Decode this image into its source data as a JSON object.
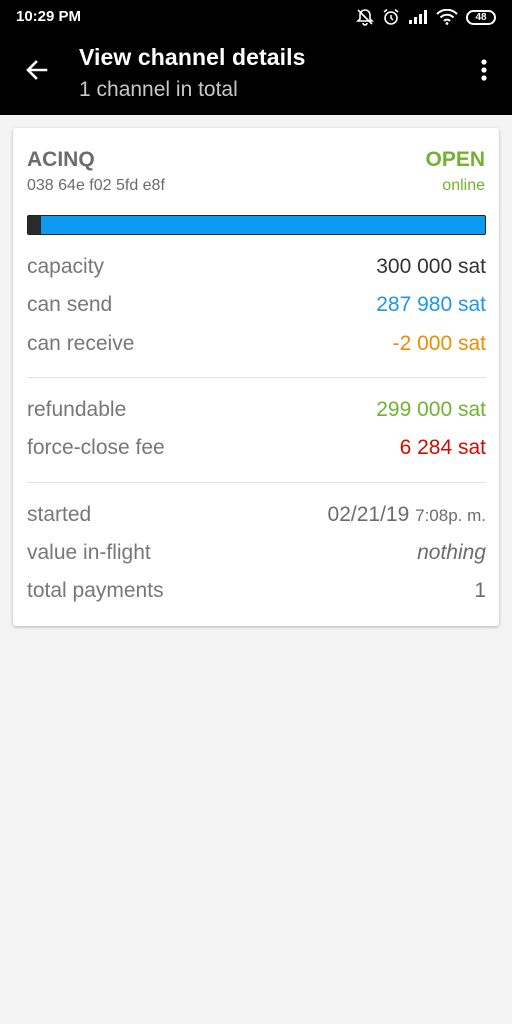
{
  "status_bar": {
    "time": "10:29 PM",
    "battery": "48",
    "icons": [
      "alarm-off-icon",
      "alarm-clock-icon",
      "signal-icon",
      "wifi-icon",
      "battery-icon"
    ]
  },
  "app_bar": {
    "title": "View channel details",
    "subtitle": "1 channel in total",
    "back_icon": "arrow-back-icon",
    "menu_icon": "overflow-menu-icon"
  },
  "channel": {
    "peer_name": "ACINQ",
    "peer_id": "038 64e f02 5fd e8f",
    "state": "OPEN",
    "connection": "online",
    "balance_fraction_local": 0.96,
    "colors": {
      "bar": "#0d9af2",
      "open": "#72b233",
      "send": "#1e96ee",
      "receive": "#ef8c00",
      "refundable": "#72b233",
      "fee": "#d20c00"
    },
    "capacity_label": "capacity",
    "capacity_value": "300 000 sat",
    "can_send_label": "can send",
    "can_send_value": "287 980 sat",
    "can_receive_label": "can receive",
    "can_receive_value": "-2 000 sat",
    "refundable_label": "refundable",
    "refundable_value": "299 000 sat",
    "force_close_fee_label": "force-close fee",
    "force_close_fee_value": "6 284 sat",
    "started_label": "started",
    "started_date": "02/21/19",
    "started_time": "7:08p. m.",
    "value_in_flight_label": "value in-flight",
    "value_in_flight_value": "nothing",
    "total_payments_label": "total payments",
    "total_payments_value": "1"
  }
}
